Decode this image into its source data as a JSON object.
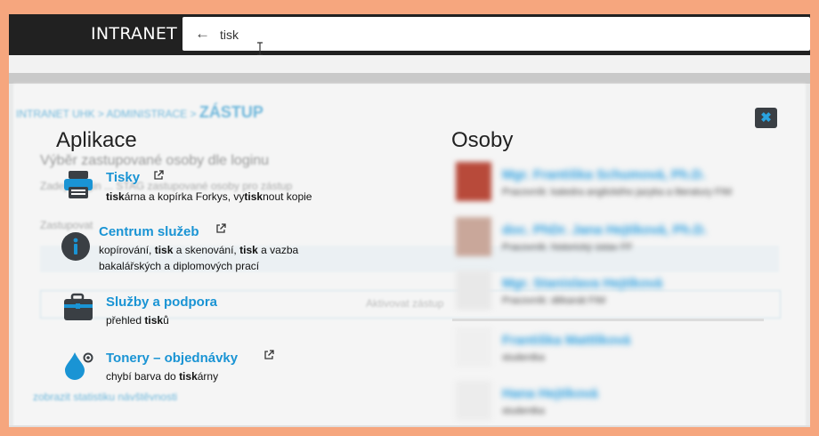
{
  "header": {
    "brand": "INTRANET",
    "search_value": "tisk"
  },
  "background_page": {
    "breadcrumb": "INTRANET UHK > ADMINISTRACE >",
    "breadcrumb_current": "ZÁSTUP",
    "heading": "Výběr zastupované osoby dle loginu",
    "text": "Zadejte login ... STAG zastupované osoby pro zástup",
    "text2": "Zastupovat",
    "button": "Aktivovat zástup",
    "stats_link": "zobrazit statistiku návštěvnosti"
  },
  "apps": {
    "title": "Aplikace",
    "items": [
      {
        "name": "Tisky",
        "icon": "printer-icon",
        "external": true,
        "desc_lines": [
          [
            {
              "t": "tisk",
              "b": true
            },
            {
              "t": "árna a kopírka Forkys, vy",
              "b": false
            },
            {
              "t": "tisk",
              "b": true
            },
            {
              "t": "nout kopie",
              "b": false
            }
          ]
        ]
      },
      {
        "name": "Centrum služeb",
        "icon": "info-icon",
        "external": true,
        "desc_lines": [
          [
            {
              "t": "kopírování, ",
              "b": false
            },
            {
              "t": "tisk",
              "b": true
            },
            {
              "t": " a skenování, ",
              "b": false
            },
            {
              "t": "tisk",
              "b": true
            },
            {
              "t": " a vazba",
              "b": false
            }
          ],
          [
            {
              "t": "bakalářských a diplomových prací",
              "b": false
            }
          ]
        ]
      },
      {
        "name": "Služby a podpora",
        "icon": "briefcase-icon",
        "external": false,
        "desc_lines": [
          [
            {
              "t": "přehled ",
              "b": false
            },
            {
              "t": "tisk",
              "b": true
            },
            {
              "t": "ů",
              "b": false
            }
          ]
        ]
      },
      {
        "name": "Tonery – objednávky",
        "icon": "ink-drop-icon",
        "external": true,
        "desc_lines": [
          [
            {
              "t": "chybí barva do ",
              "b": false
            },
            {
              "t": "tisk",
              "b": true
            },
            {
              "t": "árny",
              "b": false
            }
          ]
        ]
      }
    ]
  },
  "people": {
    "title": "Osoby",
    "items": [
      {
        "name": "Mgr. Františka Schumová, Ph.D.",
        "role": "Pracovník: katedra anglického jazyka a literatury FIM",
        "photo": "#b84a3a"
      },
      {
        "name": "doc. PhDr. Jana Hejtíková, Ph.D.",
        "role": "Pracovník: historický ústav FF",
        "photo": "#c9a79a"
      },
      {
        "name": "Mgr. Stanislava Hejtíková",
        "role": "Pracovník: děkanát FIM",
        "photo": "#e8e8e8"
      },
      {
        "name": "Františka Mattlíková",
        "role": "studentka",
        "photo": "#efefef"
      },
      {
        "name": "Hana Hejtíková",
        "role": "studentka",
        "photo": "#ececec"
      }
    ]
  },
  "colors": {
    "accent": "#1a94d4",
    "header_bg": "#212121",
    "page_border": "#f6a67e"
  }
}
